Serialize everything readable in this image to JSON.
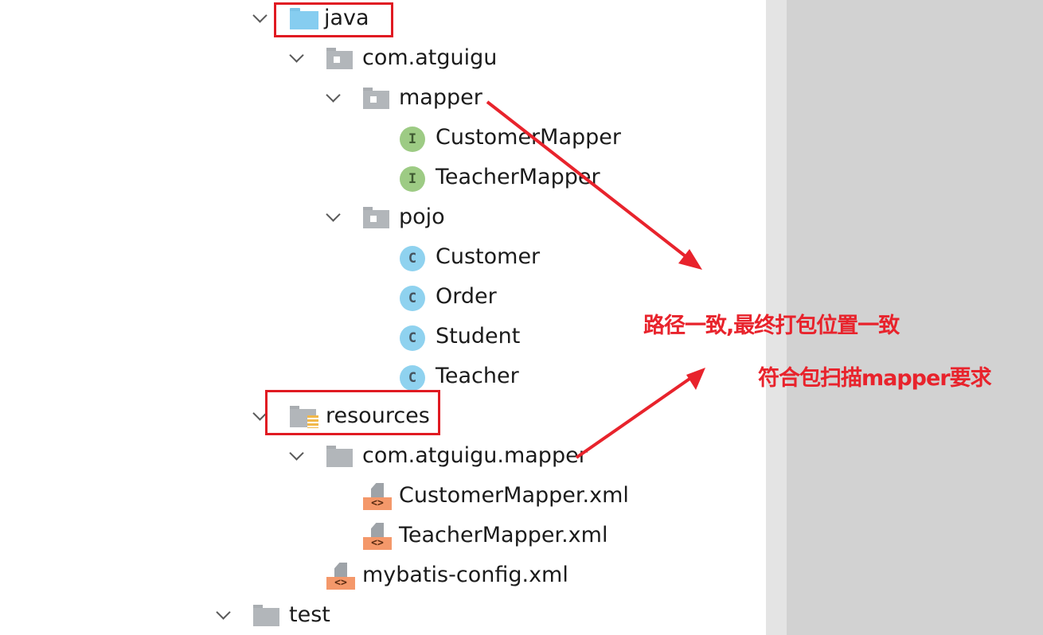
{
  "tree": {
    "nodes": [
      {
        "id": "java",
        "label": "java",
        "icon": "source-folder-icon",
        "expanded": true
      },
      {
        "id": "com-atguigu",
        "label": "com.atguigu",
        "icon": "package-icon",
        "expanded": true
      },
      {
        "id": "mapper-pkg",
        "label": "mapper",
        "icon": "package-icon",
        "expanded": true
      },
      {
        "id": "customer-mapper-iface",
        "label": "CustomerMapper",
        "icon": "interface-icon"
      },
      {
        "id": "teacher-mapper-iface",
        "label": "TeacherMapper",
        "icon": "interface-icon"
      },
      {
        "id": "pojo-pkg",
        "label": "pojo",
        "icon": "package-icon",
        "expanded": true
      },
      {
        "id": "customer-class",
        "label": "Customer",
        "icon": "class-icon"
      },
      {
        "id": "order-class",
        "label": "Order",
        "icon": "class-icon"
      },
      {
        "id": "student-class",
        "label": "Student",
        "icon": "class-icon"
      },
      {
        "id": "teacher-class",
        "label": "Teacher",
        "icon": "class-icon"
      },
      {
        "id": "resources",
        "label": "resources",
        "icon": "resources-folder-icon",
        "expanded": true
      },
      {
        "id": "com-atguigu-mapper-dir",
        "label": "com.atguigu.mapper",
        "icon": "folder-icon",
        "expanded": true
      },
      {
        "id": "customer-mapper-xml",
        "label": "CustomerMapper.xml",
        "icon": "xml-file-icon"
      },
      {
        "id": "teacher-mapper-xml",
        "label": "TeacherMapper.xml",
        "icon": "xml-file-icon"
      },
      {
        "id": "mybatis-config-xml",
        "label": "mybatis-config.xml",
        "icon": "xml-file-icon"
      },
      {
        "id": "test",
        "label": "test",
        "icon": "folder-icon",
        "expanded": true
      }
    ],
    "badge_letters": {
      "class": "C",
      "interface": "I"
    },
    "xml_tag_glyph": "<>"
  },
  "annotations": {
    "note1": "路径一致,最终打包位置一致",
    "note2": "符合包扫描mapper要求",
    "color": "#e8232c"
  },
  "colors": {
    "highlight": "#e01a22",
    "source_folder": "#86cdf0",
    "package_folder": "#b2b6ba",
    "class_badge": "#8fd2ef",
    "interface_badge": "#9dcb84",
    "xml_tag": "#f4986a",
    "gutter_light": "#e4e4e4",
    "gutter_dark": "#d2d2d2"
  }
}
